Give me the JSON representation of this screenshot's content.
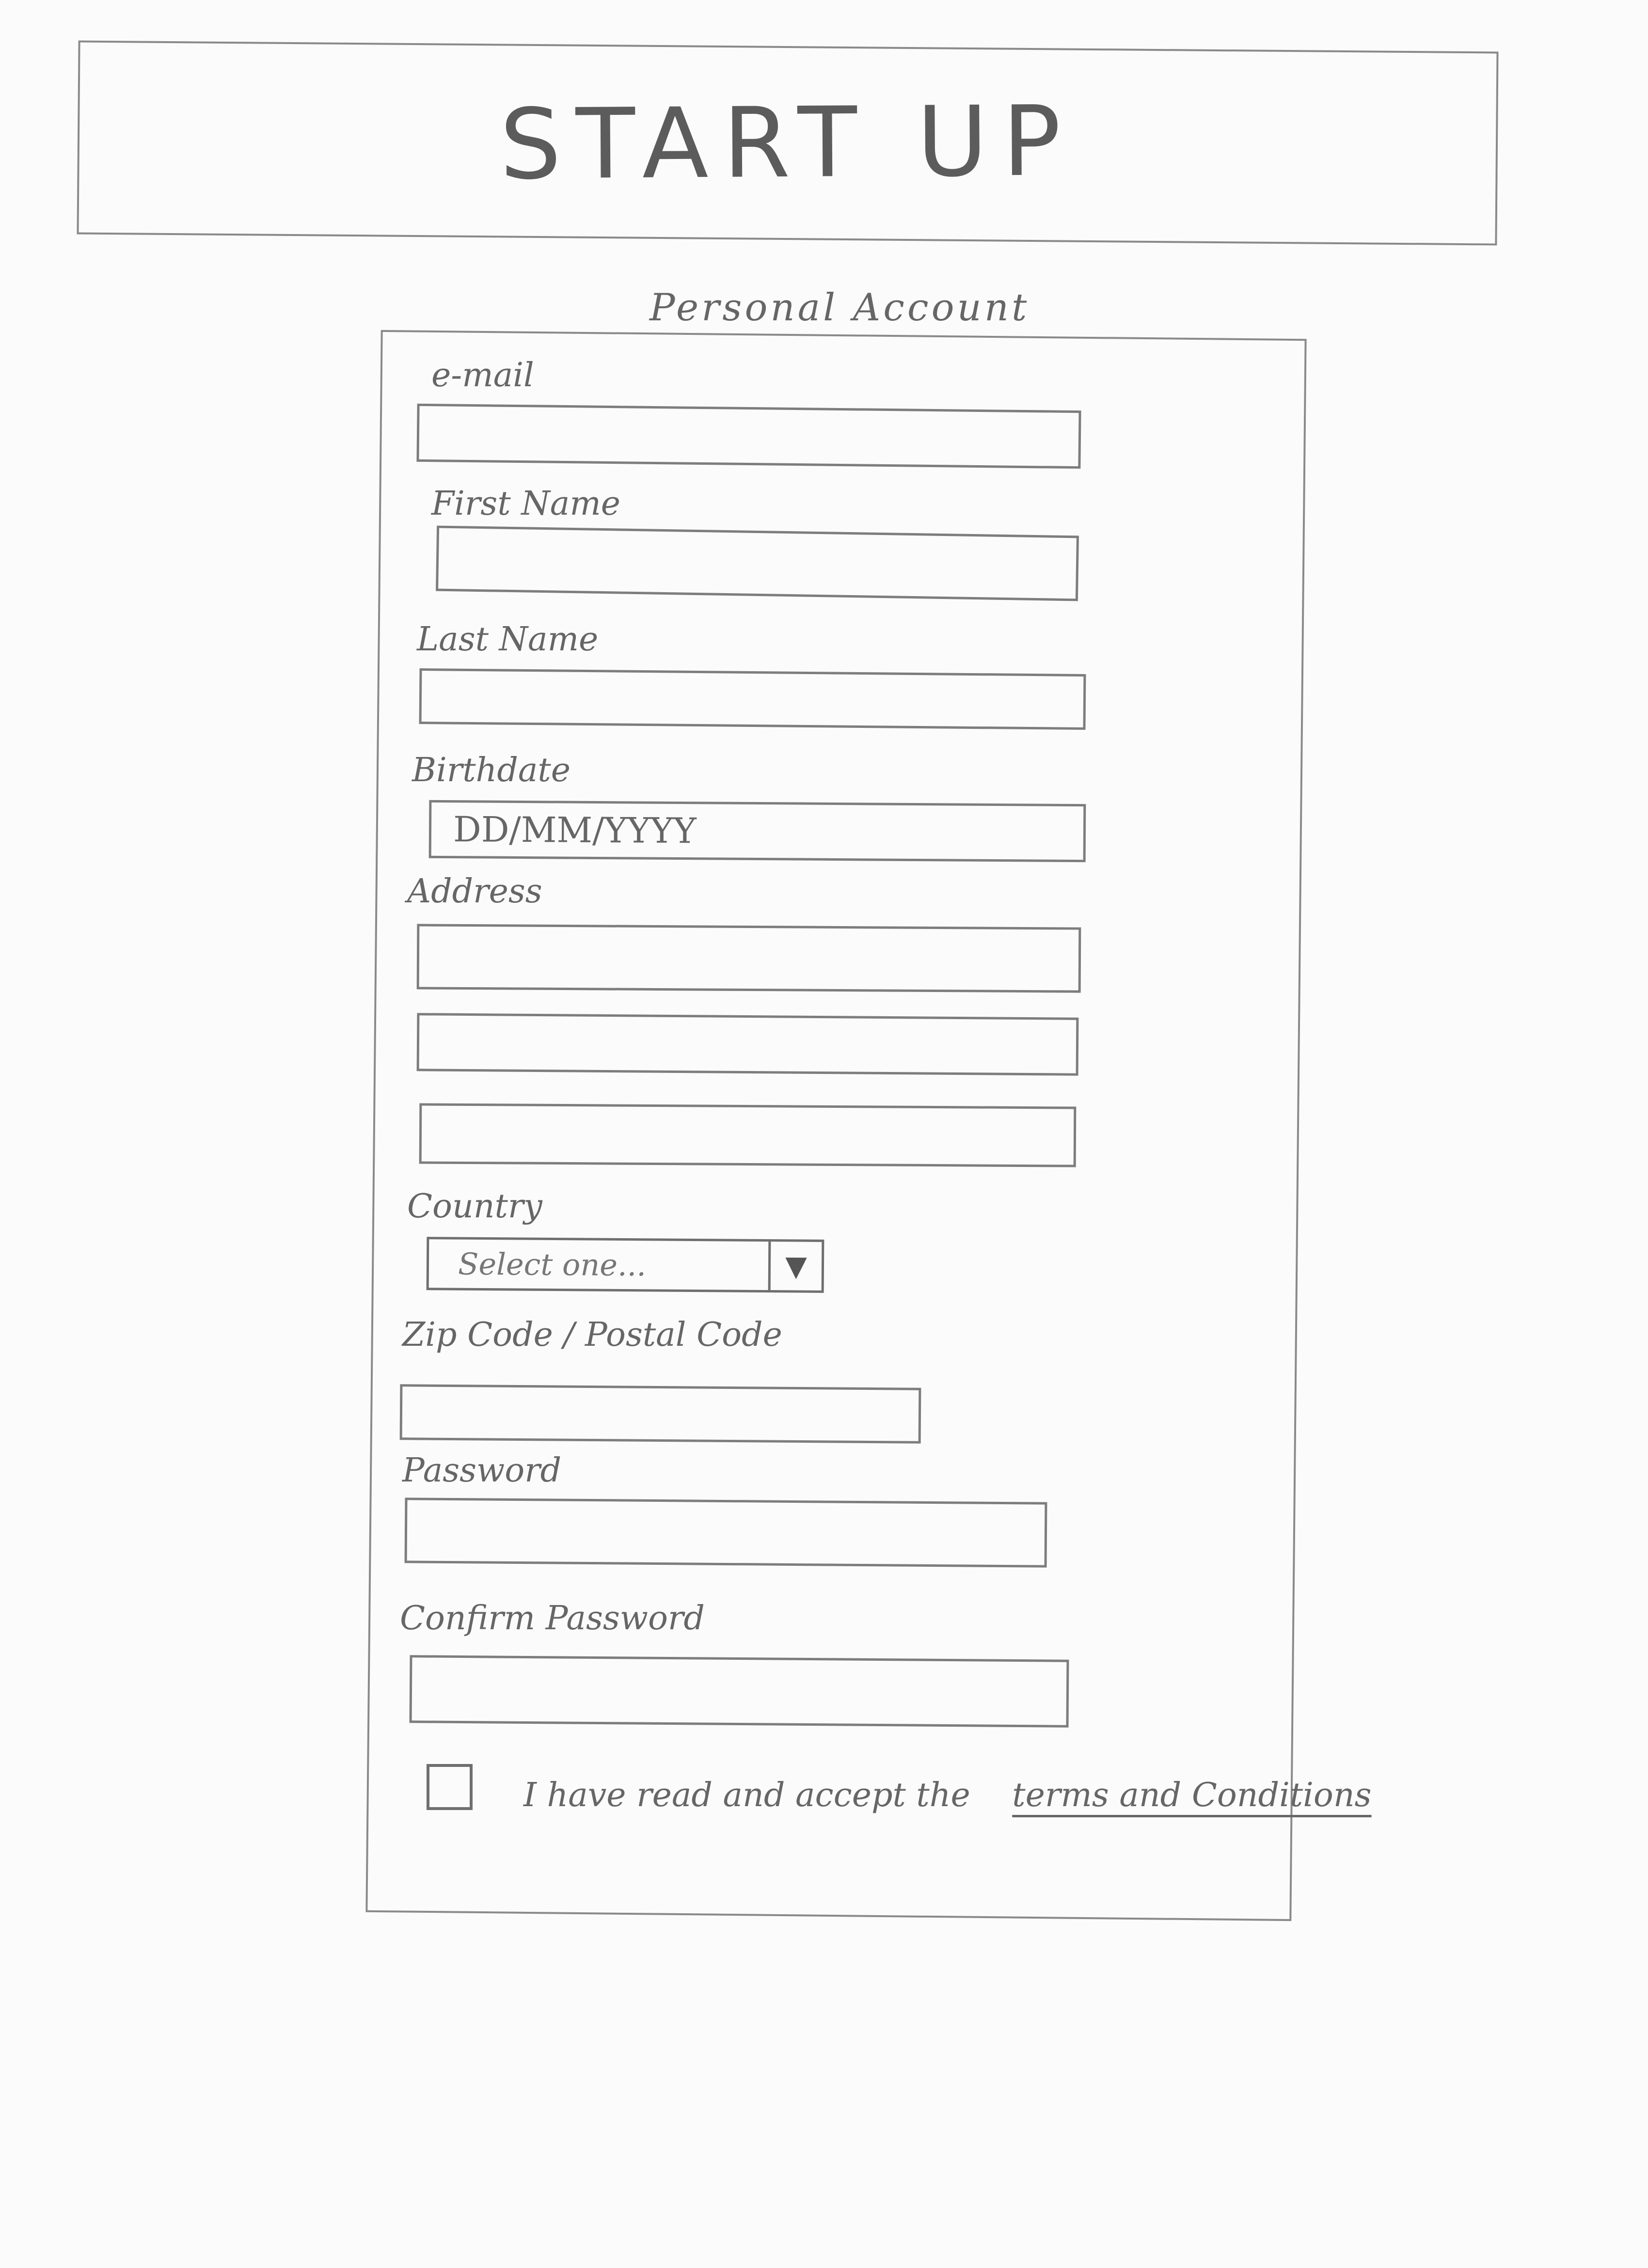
{
  "header": {
    "title": "START UP"
  },
  "section": {
    "title": "Personal Account"
  },
  "form": {
    "email": {
      "label": "e-mail",
      "value": ""
    },
    "first_name": {
      "label": "First Name",
      "value": ""
    },
    "last_name": {
      "label": "Last Name",
      "value": ""
    },
    "birthdate": {
      "label": "Birthdate",
      "placeholder": "DD/MM/YYYY"
    },
    "address": {
      "label": "Address",
      "lines": [
        "",
        "",
        ""
      ]
    },
    "country": {
      "label": "Country",
      "selected": "Select one..."
    },
    "zip": {
      "label": "Zip Code / Postal Code",
      "value": ""
    },
    "password": {
      "label": "Password",
      "value": ""
    },
    "confirm_password": {
      "label": "Confirm Password",
      "value": ""
    },
    "terms": {
      "checked": false,
      "text": "I have read and accept the",
      "link_text": "terms and Conditions"
    }
  },
  "icons": {
    "select_arrow": "chevron-down-icon"
  },
  "colors": {
    "paper": "#fbfbfb",
    "pencil": "#7d7d7d"
  }
}
